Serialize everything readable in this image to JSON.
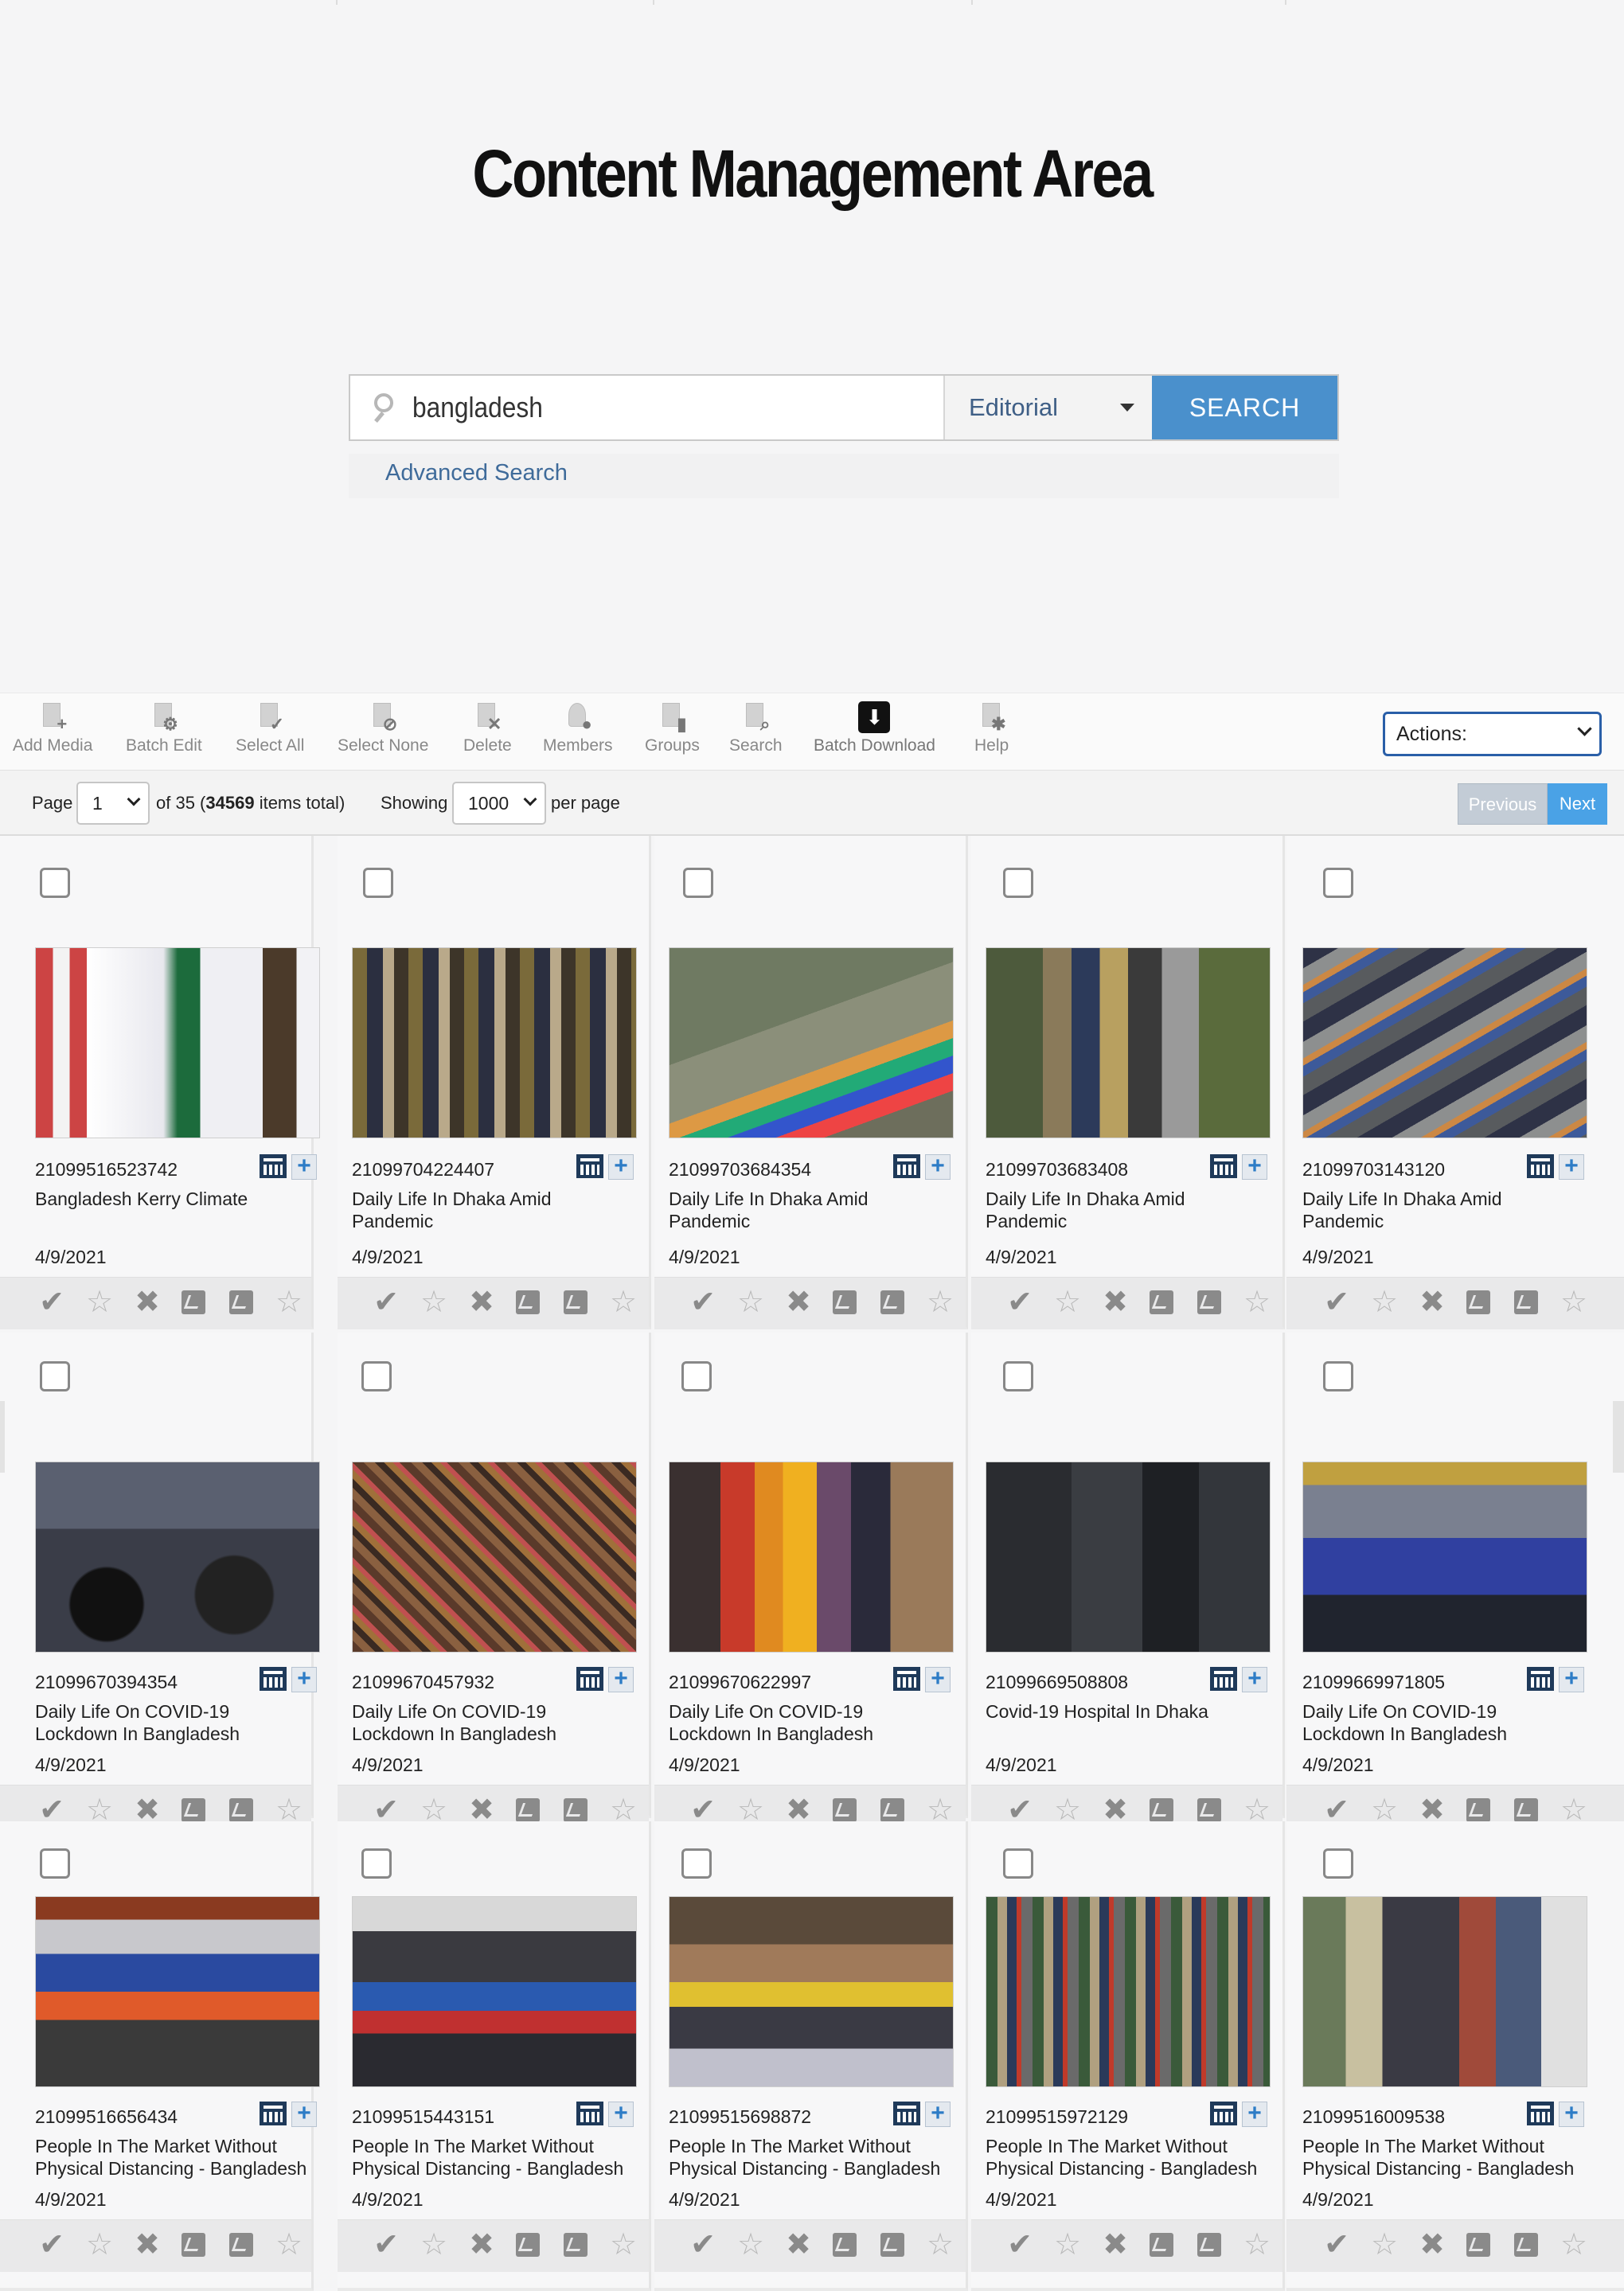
{
  "page": {
    "title": "Content Management Area"
  },
  "search": {
    "query": "bangladesh",
    "scope": "Editorial",
    "button": "SEARCH",
    "advanced": "Advanced Search"
  },
  "toolbar": {
    "add_media": "Add Media",
    "batch_edit": "Batch Edit",
    "select_all": "Select All",
    "select_none": "Select None",
    "delete": "Delete",
    "members": "Members",
    "groups": "Groups",
    "search": "Search",
    "batch_download": "Batch Download",
    "help": "Help",
    "actions_label": "Actions:"
  },
  "pager": {
    "page_label": "Page",
    "page_value": "1",
    "of_pages": "of 35 (",
    "total_items": "34569",
    "items_suffix": "items total)",
    "showing_label": "Showing",
    "per_page_value": "1000",
    "per_page_label": "per page",
    "previous": "Previous",
    "next": "Next"
  },
  "items": [
    {
      "id": "21099516523742",
      "title": "Bangladesh Kerry Climate",
      "date": "4/9/2021"
    },
    {
      "id": "21099704224407",
      "title": "Daily Life In Dhaka Amid Pandemic",
      "date": "4/9/2021"
    },
    {
      "id": "21099703684354",
      "title": "Daily Life In Dhaka Amid Pandemic",
      "date": "4/9/2021"
    },
    {
      "id": "21099703683408",
      "title": "Daily Life In Dhaka Amid Pandemic",
      "date": "4/9/2021"
    },
    {
      "id": "21099703143120",
      "title": "Daily Life In Dhaka Amid Pandemic",
      "date": "4/9/2021"
    },
    {
      "id": "21099670394354",
      "title": "Daily Life On COVID-19 Lockdown In Bangladesh",
      "date": "4/9/2021"
    },
    {
      "id": "21099670457932",
      "title": "Daily Life On COVID-19 Lockdown In Bangladesh",
      "date": "4/9/2021"
    },
    {
      "id": "21099670622997",
      "title": "Daily Life On COVID-19 Lockdown In Bangladesh",
      "date": "4/9/2021"
    },
    {
      "id": "21099669508808",
      "title": "Covid-19 Hospital In Dhaka",
      "date": "4/9/2021"
    },
    {
      "id": "21099669971805",
      "title": "Daily Life On COVID-19 Lockdown In Bangladesh",
      "date": "4/9/2021"
    },
    {
      "id": "21099516656434",
      "title": "People In The Market Without Physical Distancing - Bangladesh",
      "date": "4/9/2021"
    },
    {
      "id": "21099515443151",
      "title": "People In The Market Without Physical Distancing - Bangladesh",
      "date": "4/9/2021"
    },
    {
      "id": "21099515698872",
      "title": "People In The Market Without Physical Distancing - Bangladesh",
      "date": "4/9/2021"
    },
    {
      "id": "21099515972129",
      "title": "People In The Market Without Physical Distancing - Bangladesh",
      "date": "4/9/2021"
    },
    {
      "id": "21099516009538",
      "title": "People In The Market Without Physical Distancing - Bangladesh",
      "date": "4/9/2021"
    }
  ],
  "colors": {
    "accent": "#4a90cc",
    "next_button": "#4aa2e6",
    "link": "#3f6b9a"
  }
}
